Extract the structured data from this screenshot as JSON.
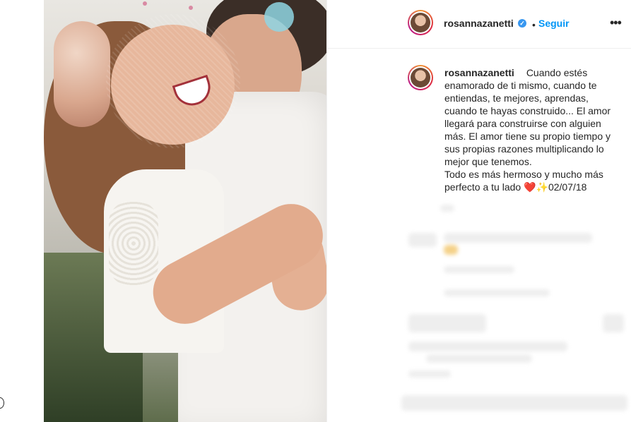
{
  "post": {
    "username": "rosannazanetti",
    "verified_mark": "✓",
    "separator": "•",
    "follow_label": "Seguir",
    "more_label": "•••",
    "caption_user": "rosannazanetti",
    "caption_text": "Cuando estés\nenamorado de ti mismo, cuando te\nentiendas, te mejores, aprendas,\ncuando te hayas construido... El amor\nllegará para construirse con alguien\nmás. El amor tiene su propio tiempo y\nsus propias razones multiplicando lo\nmejor que tenemos.\nTodo es más hermoso y mucho más\nperfecto a tu lado ❤️✨02/07/18"
  },
  "icons": {
    "verified": "verified-badge-icon",
    "more": "more-options-icon"
  },
  "colors": {
    "accent": "#0095f6",
    "verified": "#3897f0",
    "text": "#262626"
  }
}
